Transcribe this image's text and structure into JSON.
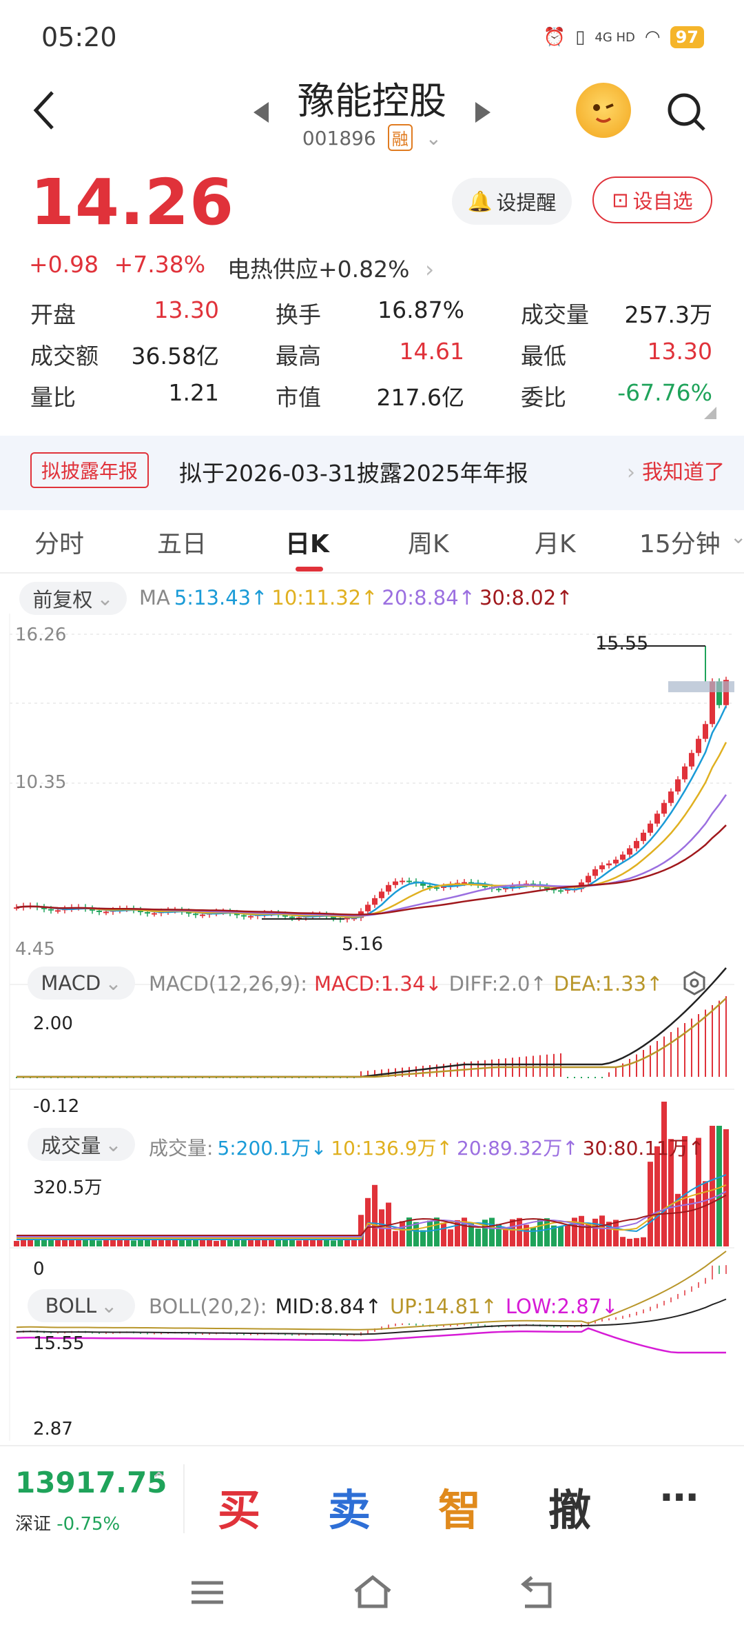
{
  "status": {
    "time": "05:20",
    "network": "4G HD",
    "battery": "97"
  },
  "header": {
    "title": "豫能控股",
    "code": "001896",
    "tag": "融"
  },
  "quote": {
    "price": "14.26",
    "change": "+0.98",
    "change_pct": "+7.38%",
    "sector": "电热供应",
    "sector_pct": "+0.82%",
    "remind_label": "设提醒",
    "watch_label": "设自选"
  },
  "stats": [
    {
      "label": "开盘",
      "value": "13.30",
      "color": "red"
    },
    {
      "label": "换手",
      "value": "16.87%",
      "color": "dark"
    },
    {
      "label": "成交量",
      "value": "257.3万",
      "color": "dark"
    },
    {
      "label": "成交额",
      "value": "36.58亿",
      "color": "dark"
    },
    {
      "label": "最高",
      "value": "14.61",
      "color": "red"
    },
    {
      "label": "最低",
      "value": "13.30",
      "color": "red"
    },
    {
      "label": "量比",
      "value": "1.21",
      "color": "dark"
    },
    {
      "label": "市值",
      "value": "217.6亿",
      "color": "dark"
    },
    {
      "label": "委比",
      "value": "-67.76%",
      "color": "green"
    }
  ],
  "notice": {
    "badge": "拟披露年报",
    "text": "拟于2026-03-31披露2025年年报",
    "action": "我知道了"
  },
  "tabs": [
    "分时",
    "五日",
    "日K",
    "周K",
    "月K",
    "15分钟"
  ],
  "active_tab": "日K",
  "kline": {
    "adjust": "前复权",
    "ma_prefix": "MA",
    "ma": [
      {
        "label": "5:13.43↑",
        "color": "#1a9bd7"
      },
      {
        "label": "10:11.32↑",
        "color": "#e0b020"
      },
      {
        "label": "20:8.84↑",
        "color": "#9b6fe0"
      },
      {
        "label": "30:8.02↑",
        "color": "#a0181c"
      }
    ],
    "y_top": "16.26",
    "y_mid": "10.35",
    "y_bottom": "4.45",
    "high_mark": "15.55",
    "low_mark": "5.16"
  },
  "macd": {
    "label": "MACD",
    "params": "MACD(12,26,9):",
    "macd": "MACD:1.34↓",
    "diff": "DIFF:2.0↑",
    "dea": "DEA:1.33↑",
    "y_top": "2.00",
    "y_bottom": "-0.12"
  },
  "volume": {
    "label": "成交量",
    "prefix": "成交量:",
    "ma": [
      {
        "label": "5:200.1万↓",
        "color": "#1a9bd7"
      },
      {
        "label": "10:136.9万↑",
        "color": "#e0b020"
      },
      {
        "label": "20:89.32万↑",
        "color": "#9b6fe0"
      },
      {
        "label": "30:80.11万↑",
        "color": "#a0181c"
      }
    ],
    "y_top": "320.5万",
    "y_bottom": "0"
  },
  "boll": {
    "label": "BOLL",
    "params": "BOLL(20,2):",
    "mid": "MID:8.84↑",
    "up": "UP:14.81↑",
    "low": "LOW:2.87↓",
    "y_top": "15.55",
    "y_bottom": "2.87"
  },
  "bottom": {
    "index_value": "13917.75",
    "index_name": "深证",
    "index_pct": "-0.75%",
    "buy": "买",
    "sell": "卖",
    "smart": "智",
    "cancel": "撤",
    "more": "⋯"
  },
  "colors": {
    "up": "#e0323a",
    "down": "#1fa35a",
    "accent": "#e0323a"
  }
}
